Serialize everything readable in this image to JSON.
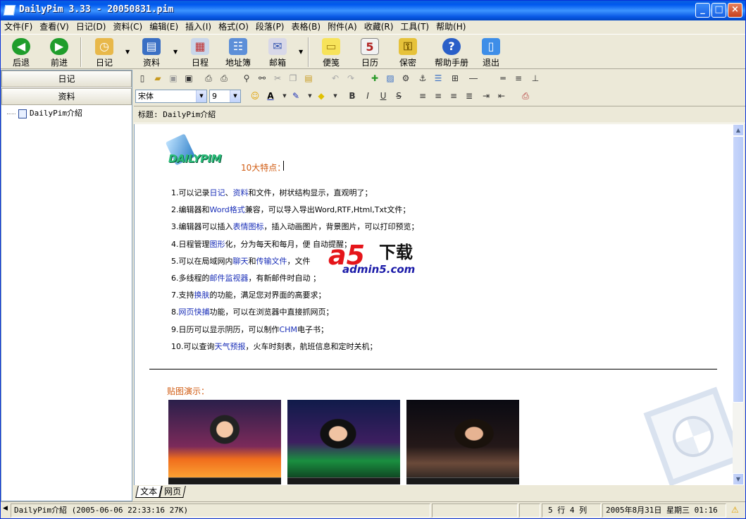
{
  "window": {
    "title": "DailyPim 3.33 - 20050831.pim",
    "min": "_",
    "max": "□",
    "close": "×"
  },
  "menu": [
    "文件(F)",
    "查看(V)",
    "日记(D)",
    "资料(C)",
    "编辑(E)",
    "插入(I)",
    "格式(O)",
    "段落(P)",
    "表格(B)",
    "附件(A)",
    "收藏(R)",
    "工具(T)",
    "帮助(H)"
  ],
  "toolbar": {
    "back": "后退",
    "forward": "前进",
    "diary": "日记",
    "data": "资料",
    "schedule": "日程",
    "addressbook": "地址簿",
    "mail": "邮箱",
    "notes": "便笺",
    "calendar": "日历",
    "secret": "保密",
    "help": "帮助手册",
    "exit": "退出"
  },
  "left": {
    "tab_diary": "日记",
    "tab_data": "资料",
    "tree_item": "DailyPim介紹"
  },
  "format": {
    "font": "宋体",
    "size": "9",
    "b": "B",
    "i": "I",
    "u": "U",
    "s": "S"
  },
  "doc": {
    "title_row": "标题: DailyPim介紹",
    "logo_text": "DAILYPIM",
    "heading": "10大特点：",
    "features": [
      [
        "1.可以记录",
        "日记",
        "、",
        "资料",
        "和文件，树状结构显示，直观明了；"
      ],
      [
        "2.编辑器和",
        "Word格式",
        "兼容，可以导入导出Word,RTF,Html,Txt文件；",
        "",
        ""
      ],
      [
        "3.编辑器可以插入",
        "表情图标",
        "，插入动画图片，背景图片，可以打印预览；",
        "",
        ""
      ],
      [
        "4.日程管理",
        "图形",
        "化，分为每天和每月，便                              自动提醒；",
        "",
        ""
      ],
      [
        "5.可以在局域网内",
        "聊天",
        "和",
        "传输文件",
        "，文件"
      ],
      [
        "6.多线程的",
        "邮件监视器",
        "，有新邮件时自动                              ；",
        "",
        ""
      ],
      [
        "7.支持",
        "换肤",
        "的功能，满足您对界面的高要求；",
        "",
        ""
      ],
      [
        "8.",
        "网页快捕",
        "功能，可以在浏览器中直接抓网页；",
        "",
        ""
      ],
      [
        "9.日历可以显示阴历，可以制作",
        "CHM",
        "电子书；",
        "",
        ""
      ],
      [
        "10.可以查询",
        "天气预报",
        "，火车时刻表，航班信息和定时关机；",
        "",
        ""
      ]
    ],
    "demo_label": "贴图演示：",
    "watermark": {
      "big": "a5",
      "dl": "下载",
      "url": "admin5.com"
    }
  },
  "tabs": {
    "text": "文本",
    "web": "网页"
  },
  "status": {
    "file": "DailyPim介紹 (2005-06-06 22:33:16 27K)",
    "pos": "5 行  4 列",
    "datetime": "2005年8月31日 星期三 01:16"
  }
}
